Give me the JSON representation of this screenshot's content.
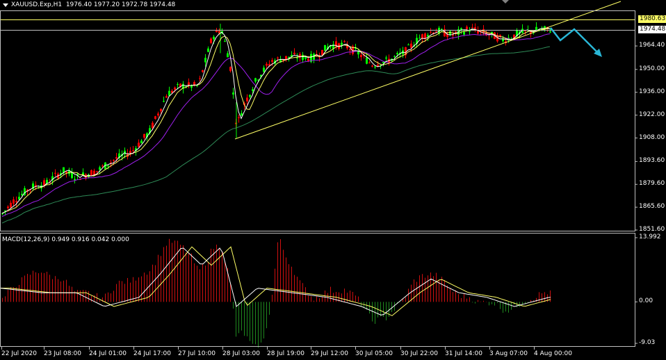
{
  "header": {
    "symbol_label": "XAUUSD.Exp,H1",
    "ohlc": "1976.40 1977.20 1972.78 1974.48"
  },
  "price_axis": {
    "labels": [
      "1980.63",
      "1974.48",
      "1964.40",
      "1950.00",
      "1936.00",
      "1922.00",
      "1908.00",
      "1893.60",
      "1879.60",
      "1865.60",
      "1851.60"
    ],
    "high_line_label": "1980.63",
    "current_label": "1974.48"
  },
  "macd": {
    "title": "MACD(12,26,9) 0.949 0.916 0.042 0.000",
    "axis_labels": [
      "13.992",
      "0.00",
      "-9.03"
    ]
  },
  "time_axis": {
    "labels": [
      "22 Jul 2020",
      "23 Jul 08:00",
      "24 Jul 01:00",
      "24 Jul 17:00",
      "27 Jul 10:00",
      "28 Jul 03:00",
      "28 Jul 19:00",
      "29 Jul 12:00",
      "30 Jul 05:00",
      "30 Jul 22:00",
      "31 Jul 14:00",
      "3 Aug 07:00",
      "4 Aug 00:00"
    ]
  },
  "colors": {
    "background": "#000000",
    "bull": "#00ff00",
    "bear": "#ff0000",
    "ma_fast": "#ffffff",
    "ma_slow": "#ffff66",
    "ma_purple": "#a020f0",
    "ma_green": "#2e8b57",
    "trendline": "#ffff66",
    "arrow": "#29b6d6",
    "macd_up": "#d01010",
    "macd_down": "#1f8a1f"
  },
  "chart_data": {
    "type": "candlestick",
    "series": [
      {
        "name": "price",
        "x": [
          "22 Jul 2020",
          "23 Jul 08:00",
          "24 Jul 01:00",
          "24 Jul 17:00",
          "27 Jul 10:00",
          "28 Jul 03:00",
          "28 Jul 19:00",
          "29 Jul 12:00",
          "30 Jul 05:00",
          "30 Jul 22:00",
          "31 Jul 14:00",
          "3 Aug 07:00",
          "4 Aug 00:00"
        ],
        "values": [
          1860,
          1884,
          1889,
          1900,
          1930,
          1910,
          1945,
          1960,
          1948,
          1972,
          1968,
          1970,
          1974.48
        ]
      },
      {
        "name": "MACD",
        "values": [
          3,
          2,
          -1,
          2,
          12,
          -6,
          4,
          1,
          -3,
          5,
          1,
          -1,
          0.949
        ]
      }
    ],
    "ylim": [
      1851.6,
      1980.63
    ],
    "macd_ylim": [
      -9.03,
      13.992
    ]
  }
}
